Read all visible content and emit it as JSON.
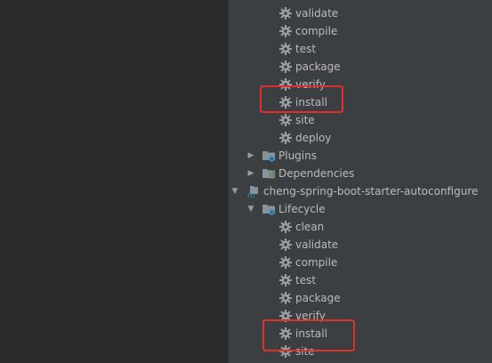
{
  "tree": {
    "phases_top": [
      "validate",
      "compile",
      "test",
      "package",
      "verify",
      "install",
      "site",
      "deploy"
    ],
    "plugins_label": "Plugins",
    "dependencies_label": "Dependencies",
    "module_label": "cheng-spring-boot-starter-autoconfigure",
    "lifecycle_label": "Lifecycle",
    "phases_bottom": [
      "clean",
      "validate",
      "compile",
      "test",
      "package",
      "verify",
      "install",
      "site"
    ]
  },
  "colors": {
    "panel_bg": "#3c3f41",
    "editor_bg": "#2b2b2b",
    "text": "#bbbbbb",
    "highlight_box": "#e0302a"
  }
}
